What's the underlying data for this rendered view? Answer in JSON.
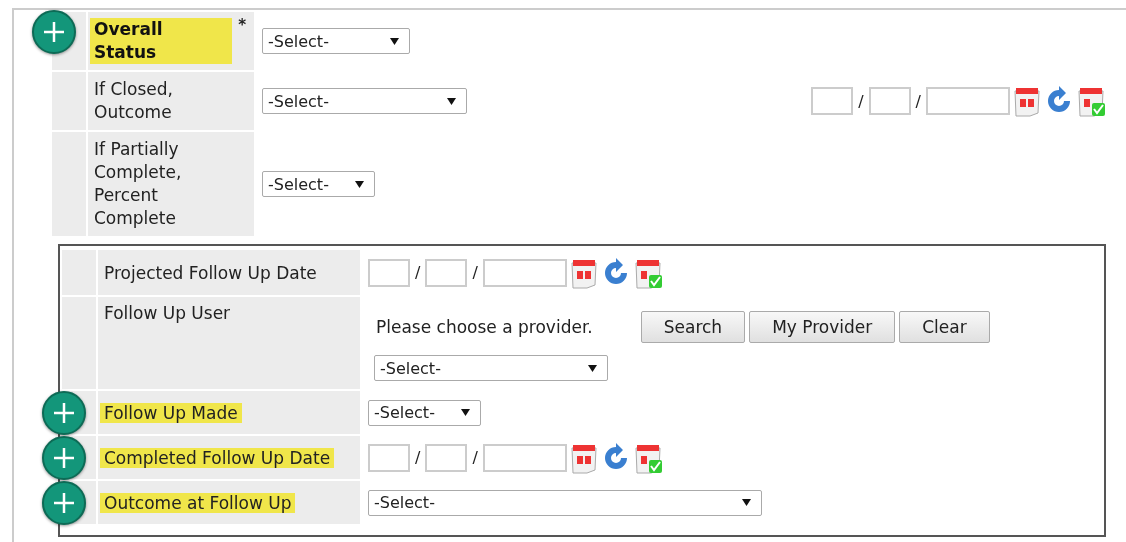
{
  "top_rows": [
    {
      "label": "Overall Status",
      "bold": true,
      "highlighted": true,
      "add_button": true,
      "required_mark": "*",
      "field": {
        "kind": "select",
        "value": "-Select-"
      }
    },
    {
      "label": "If Closed, Outcome",
      "bold": false,
      "highlighted": false,
      "add_button": false,
      "field": {
        "kind": "select",
        "value": "-Select-"
      },
      "extra": {
        "kind": "date",
        "separators": [
          "/",
          "/"
        ]
      }
    },
    {
      "label": "If Partially Complete, Percent Complete",
      "bold": false,
      "highlighted": false,
      "add_button": false,
      "field": {
        "kind": "select",
        "value": "-Select-"
      }
    }
  ],
  "follow_up_rows": [
    {
      "label": "Projected Follow Up Date",
      "highlighted": false,
      "add_button": false,
      "field": {
        "kind": "date",
        "separators": [
          "/",
          "/"
        ]
      }
    },
    {
      "label": "Follow Up User",
      "highlighted": false,
      "add_button": false,
      "field": {
        "kind": "provider",
        "note": "Please choose a provider.",
        "buttons": [
          "Search",
          "My Provider",
          "Clear"
        ],
        "value": "-Select-"
      }
    },
    {
      "label": "Follow Up Made",
      "highlighted": true,
      "add_button": true,
      "field": {
        "kind": "select",
        "value": "-Select-"
      }
    },
    {
      "label": "Completed Follow Up Date",
      "highlighted": true,
      "add_button": true,
      "field": {
        "kind": "date",
        "separators": [
          "/",
          "/"
        ]
      }
    },
    {
      "label": "Outcome at Follow Up",
      "highlighted": true,
      "add_button": true,
      "field": {
        "kind": "select",
        "value": "-Select-"
      }
    }
  ]
}
